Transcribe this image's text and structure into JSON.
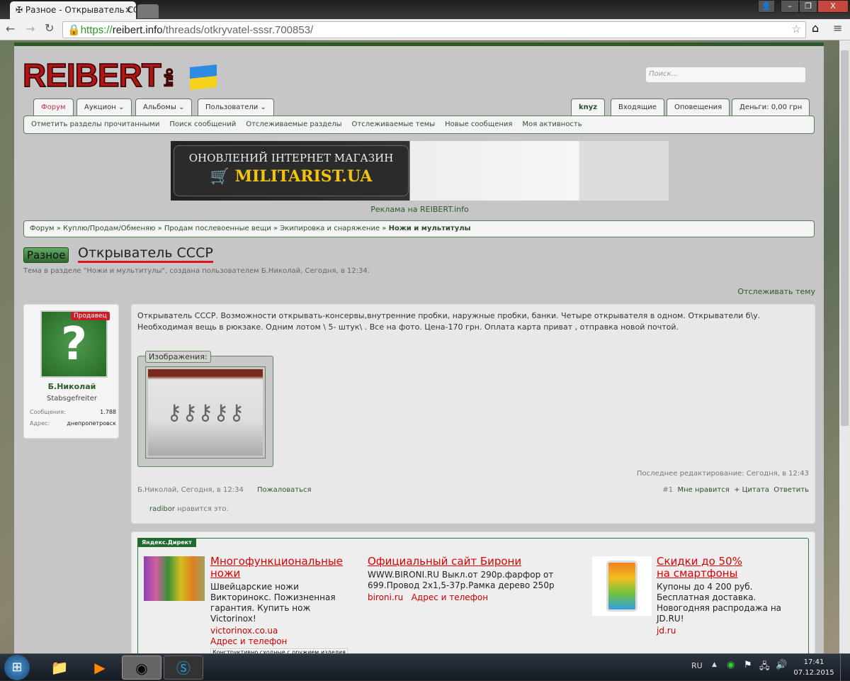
{
  "browser": {
    "tab_title": "Разное - Открыватель СС",
    "url_scheme": "https://",
    "url_host": "reibert.info",
    "url_path": "/threads/otkryvatel-sssr.700853/"
  },
  "header": {
    "logo": "REIBERT",
    "logo_sub": "info",
    "search_placeholder": "Поиск..."
  },
  "nav": {
    "tabs": [
      "Форум",
      "Аукцион",
      "Альбомы",
      "Пользователи"
    ],
    "user_tabs": [
      "knyz",
      "Входящие",
      "Оповещения",
      "Деньги: 0,00 грн"
    ],
    "subnav": [
      "Отметить разделы прочитанными",
      "Поиск сообщений",
      "Отслеживаемые разделы",
      "Отслеживаемые темы",
      "Новые сообщения",
      "Моя активность"
    ]
  },
  "banner": {
    "line1": "ОНОВЛЕНИЙ ІНТЕРНЕТ МАГАЗИН",
    "line2": "MILITARIST.UA",
    "caption": "Реклама на REIBERT.info"
  },
  "breadcrumb": [
    "Форум",
    "Куплю/Продам/Обменяю",
    "Продам послевоенные вещи",
    "Экипировка и снаряжение",
    "Ножи и мультитулы"
  ],
  "thread": {
    "prefix": "Разное",
    "title": "Открыватель СССР",
    "subtitle": "Тема в разделе \"Ножи и мультитулы\", создана пользователем Б.Николай, Сегодня, в 12:34.",
    "watch": "Отслеживать тему"
  },
  "user": {
    "badge": "Продавец",
    "name": "Б.Николай",
    "rank": "Stabsgefreiter",
    "messages_label": "Сообщения:",
    "messages": "1.788",
    "address_label": "Адрес:",
    "address": "днепропетровск"
  },
  "post": {
    "text": "Открыватель СССР. Возможности открывать-консервы,внутренние пробки, наружные пробки, банки. Четыре открывателя в одном. Открыватели б\\у. Необходимая вещь в рюкзаке. Одним лотом \\ 5- штук\\ . Все на фото. Цена-170 грн. Оплата карта приват , отправка новой почтой.",
    "images_label": "Изображения:",
    "edited": "Последнее редактирование: Сегодня, в 12:43",
    "author_date": "Б.Николай, Сегодня, в 12:34",
    "report": "Пожаловаться",
    "number": "#1",
    "like": "Мне нравится",
    "quote": "+ Цитата",
    "reply": "Ответить",
    "likes_user": "radibor",
    "likes_text": " нравится это."
  },
  "ads": {
    "label": "Яндекс.Директ",
    "items": [
      {
        "title": "Многофункциональные ножи",
        "text": "Швейцарские ножи Викторинокс. Пожизненная гарантия. Купить нож Victorinox!",
        "domain": "victorinox.co.ua",
        "extra": "Адрес и телефон",
        "tooltip": "Конструктивно сходные с оружием изделия"
      },
      {
        "title": "Официальный сайт Бирони",
        "text": "WWW.BIRONI.RU Выкл.от 290р.фарфор от 699.Провод 2х1,5-37р.Рамка дерево 250р",
        "domain": "bironi.ru",
        "extra": "Адрес и телефон"
      },
      {
        "title": "Скидки до 50% на смартфоны",
        "text": "Купоны до 4 200 руб. Бесплатная доставка. Новогодняя распродажа на JD.RU!",
        "domain": "jd.ru"
      }
    ]
  },
  "taskbar": {
    "lang": "RU",
    "time": "17:41",
    "date": "07.12.2015"
  }
}
